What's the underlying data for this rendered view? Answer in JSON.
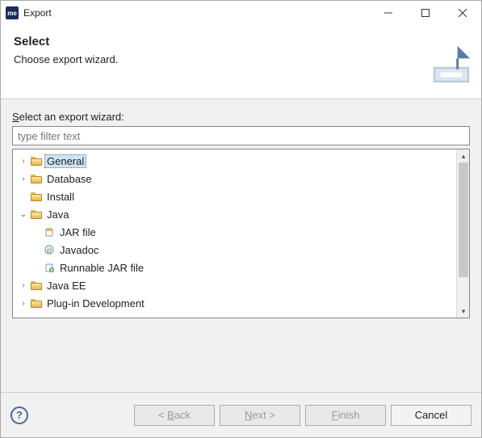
{
  "window": {
    "title": "Export",
    "appIconText": "me"
  },
  "header": {
    "heading": "Select",
    "subheading": "Choose export wizard."
  },
  "body": {
    "treeLabel": "Select an export wizard:",
    "filterPlaceholder": "type filter text"
  },
  "tree": {
    "nodes": [
      {
        "label": "General",
        "expanded": false,
        "selected": true,
        "type": "folder"
      },
      {
        "label": "Database",
        "expanded": false,
        "type": "folder"
      },
      {
        "label": "Install",
        "expanded": false,
        "type": "folder",
        "noexp": true
      },
      {
        "label": "Java",
        "expanded": true,
        "type": "folder",
        "children": [
          {
            "label": "JAR file",
            "icon": "jar"
          },
          {
            "label": "Javadoc",
            "icon": "javadoc"
          },
          {
            "label": "Runnable JAR file",
            "icon": "runjar"
          }
        ]
      },
      {
        "label": "Java EE",
        "expanded": false,
        "type": "folder"
      },
      {
        "label": "Plug-in Development",
        "expanded": false,
        "type": "folder"
      }
    ]
  },
  "buttons": {
    "back": "< Back",
    "next": "Next >",
    "finish": "Finish",
    "cancel": "Cancel"
  }
}
